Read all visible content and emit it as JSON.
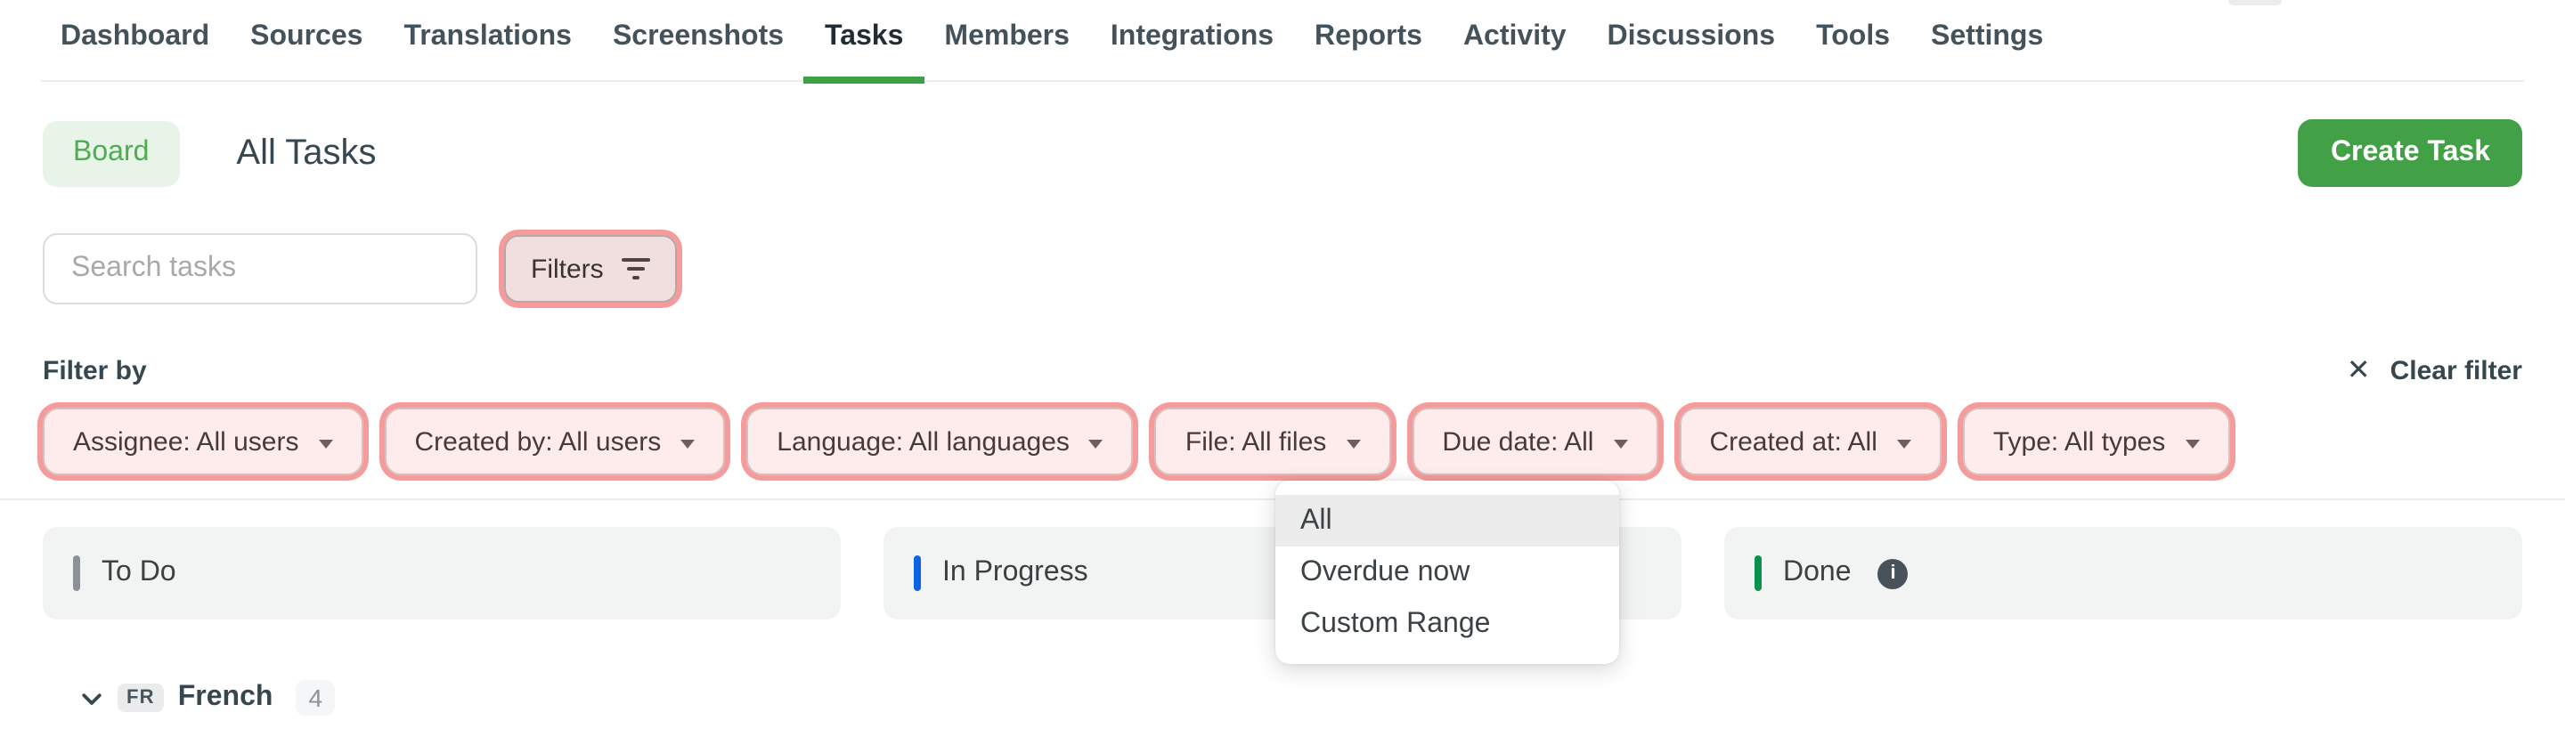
{
  "colors": {
    "accent_green": "#3da044",
    "create_button_green": "#42a046",
    "focus_ring_pink": "#f59b9b",
    "chip_background": "#fdeceb",
    "todo_gray": "#8a9297",
    "in_progress_blue": "#0e63e3",
    "done_green": "#0a9150"
  },
  "nav": {
    "items": [
      "Dashboard",
      "Sources",
      "Translations",
      "Screenshots",
      "Tasks",
      "Members",
      "Integrations",
      "Reports",
      "Activity",
      "Discussions",
      "Tools",
      "Settings"
    ],
    "active": "Tasks"
  },
  "toolbar": {
    "view_toggle": "Board",
    "title": "All Tasks",
    "create_button": "Create Task"
  },
  "search": {
    "placeholder": "Search tasks"
  },
  "filters_button": {
    "label": "Filters",
    "icon": "filter-lines-icon"
  },
  "filter_panel": {
    "label": "Filter by",
    "clear_label": "Clear filter",
    "clear_icon": "x-icon",
    "chips": [
      {
        "label": "Assignee: All users"
      },
      {
        "label": "Created by: All users"
      },
      {
        "label": "Language: All languages"
      },
      {
        "label": "File: All files"
      },
      {
        "label": "Due date: All"
      },
      {
        "label": "Created at: All"
      },
      {
        "label": "Type: All types"
      }
    ]
  },
  "due_date_menu": {
    "selected": "All",
    "items": [
      "All",
      "Overdue now",
      "Custom Range"
    ]
  },
  "board": {
    "columns": [
      {
        "label": "To Do",
        "color": "#8a9297"
      },
      {
        "label": "In Progress",
        "color": "#0e63e3"
      },
      {
        "label": "Done",
        "color": "#0a9150",
        "info_icon": "i"
      }
    ]
  },
  "language_group": {
    "code": "FR",
    "name": "French",
    "count": "4"
  }
}
